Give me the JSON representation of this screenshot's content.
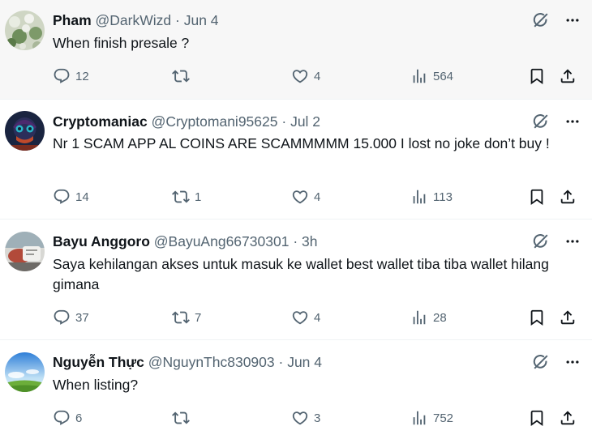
{
  "tweets": [
    {
      "name": "Pham",
      "handle": "@DarkWizd",
      "dot": "·",
      "time": "Jun 4",
      "text": "When finish presale ?",
      "replies": "12",
      "retweets": "",
      "likes": "4",
      "views": "564",
      "highlighted": true
    },
    {
      "name": "Cryptomaniac",
      "handle": "@Cryptomani95625",
      "dot": "·",
      "time": "Jul 2",
      "text": "Nr 1 SCAM APP AL COINS ARE SCAMMMMM 15.000 I lost no joke don’t buy !",
      "replies": "14",
      "retweets": "1",
      "likes": "4",
      "views": "113",
      "highlighted": false
    },
    {
      "name": "Bayu Anggoro",
      "handle": "@BayuAng66730301",
      "dot": "·",
      "time": "3h",
      "text": "Saya kehilangan akses untuk masuk ke wallet best wallet tiba tiba wallet hilang gimana",
      "replies": "37",
      "retweets": "7",
      "likes": "4",
      "views": "28",
      "highlighted": false
    },
    {
      "name": "Nguyễn Thực",
      "handle": "@NguynThc830903",
      "dot": "·",
      "time": "Jun 4",
      "text": "When listing?",
      "replies": "6",
      "retweets": "",
      "likes": "3",
      "views": "752",
      "highlighted": false
    }
  ],
  "icons": {
    "grok": "grok-icon",
    "more": "more-icon",
    "reply": "reply-icon",
    "retweet": "retweet-icon",
    "like": "heart-icon",
    "views": "views-icon",
    "bookmark": "bookmark-icon",
    "share": "share-icon"
  },
  "colors": {
    "text": "#0f1419",
    "muted": "#536471",
    "highlight_bg": "#f7f7f7",
    "divider": "#eff3f4"
  }
}
